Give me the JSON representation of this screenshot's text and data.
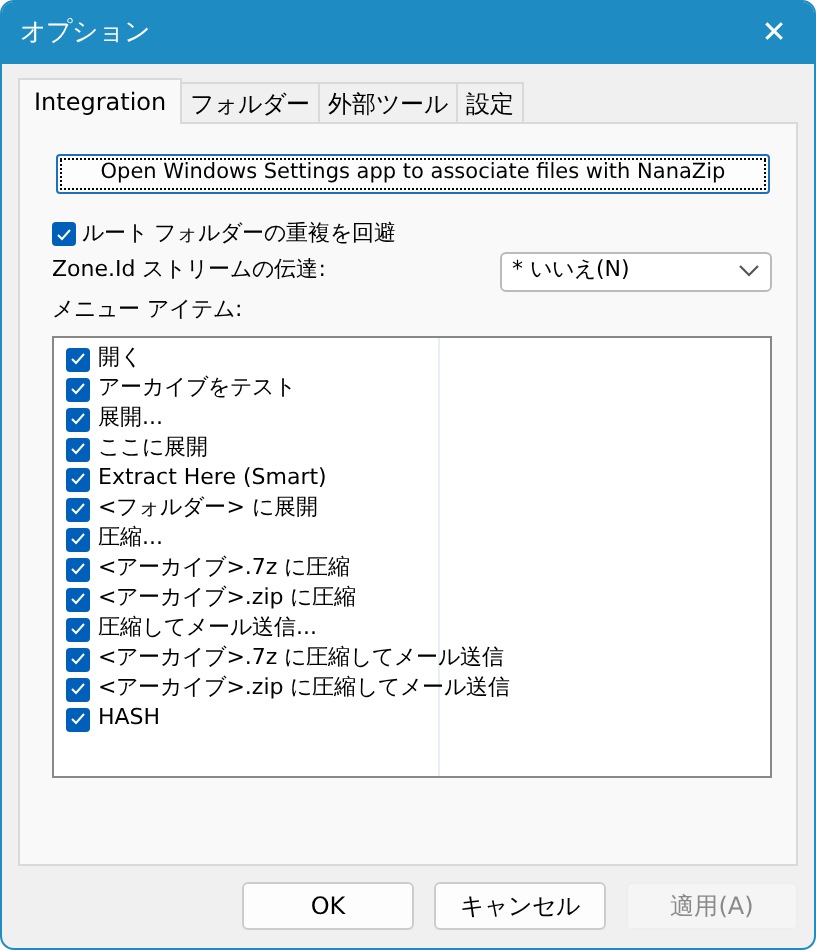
{
  "window": {
    "title": "オプション",
    "close": "✕"
  },
  "tabs": [
    {
      "label": "Integration",
      "selected": true
    },
    {
      "label": "フォルダー",
      "selected": false
    },
    {
      "label": "外部ツール",
      "selected": false
    },
    {
      "label": "設定",
      "selected": false
    }
  ],
  "associate_button": {
    "label": "Open Windows Settings app to associate files with NanaZip",
    "focused": true
  },
  "avoid_duplicate_root": {
    "label": "ルート フォルダーの重複を回避",
    "checked": true
  },
  "zone_id": {
    "label": "Zone.Id ストリームの伝達:",
    "value": "* いいえ(N)"
  },
  "menu_items_label": "メニュー アイテム:",
  "menu_items": [
    {
      "label": "開く",
      "checked": true
    },
    {
      "label": "アーカイブをテスト",
      "checked": true
    },
    {
      "label": "展開...",
      "checked": true
    },
    {
      "label": "ここに展開",
      "checked": true
    },
    {
      "label": "Extract Here (Smart)",
      "checked": true
    },
    {
      "label": "<フォルダー> に展開",
      "checked": true
    },
    {
      "label": "圧縮...",
      "checked": true
    },
    {
      "label": "<アーカイブ>.7z に圧縮",
      "checked": true
    },
    {
      "label": "<アーカイブ>.zip に圧縮",
      "checked": true
    },
    {
      "label": "圧縮してメール送信...",
      "checked": true
    },
    {
      "label": "<アーカイブ>.7z に圧縮してメール送信",
      "checked": true
    },
    {
      "label": "<アーカイブ>.zip に圧縮してメール送信",
      "checked": true
    },
    {
      "label": "HASH",
      "checked": true
    }
  ],
  "buttons": [
    {
      "label": "OK",
      "disabled": false
    },
    {
      "label": "キャンセル",
      "disabled": false
    },
    {
      "label": "適用(A)",
      "disabled": true
    }
  ]
}
